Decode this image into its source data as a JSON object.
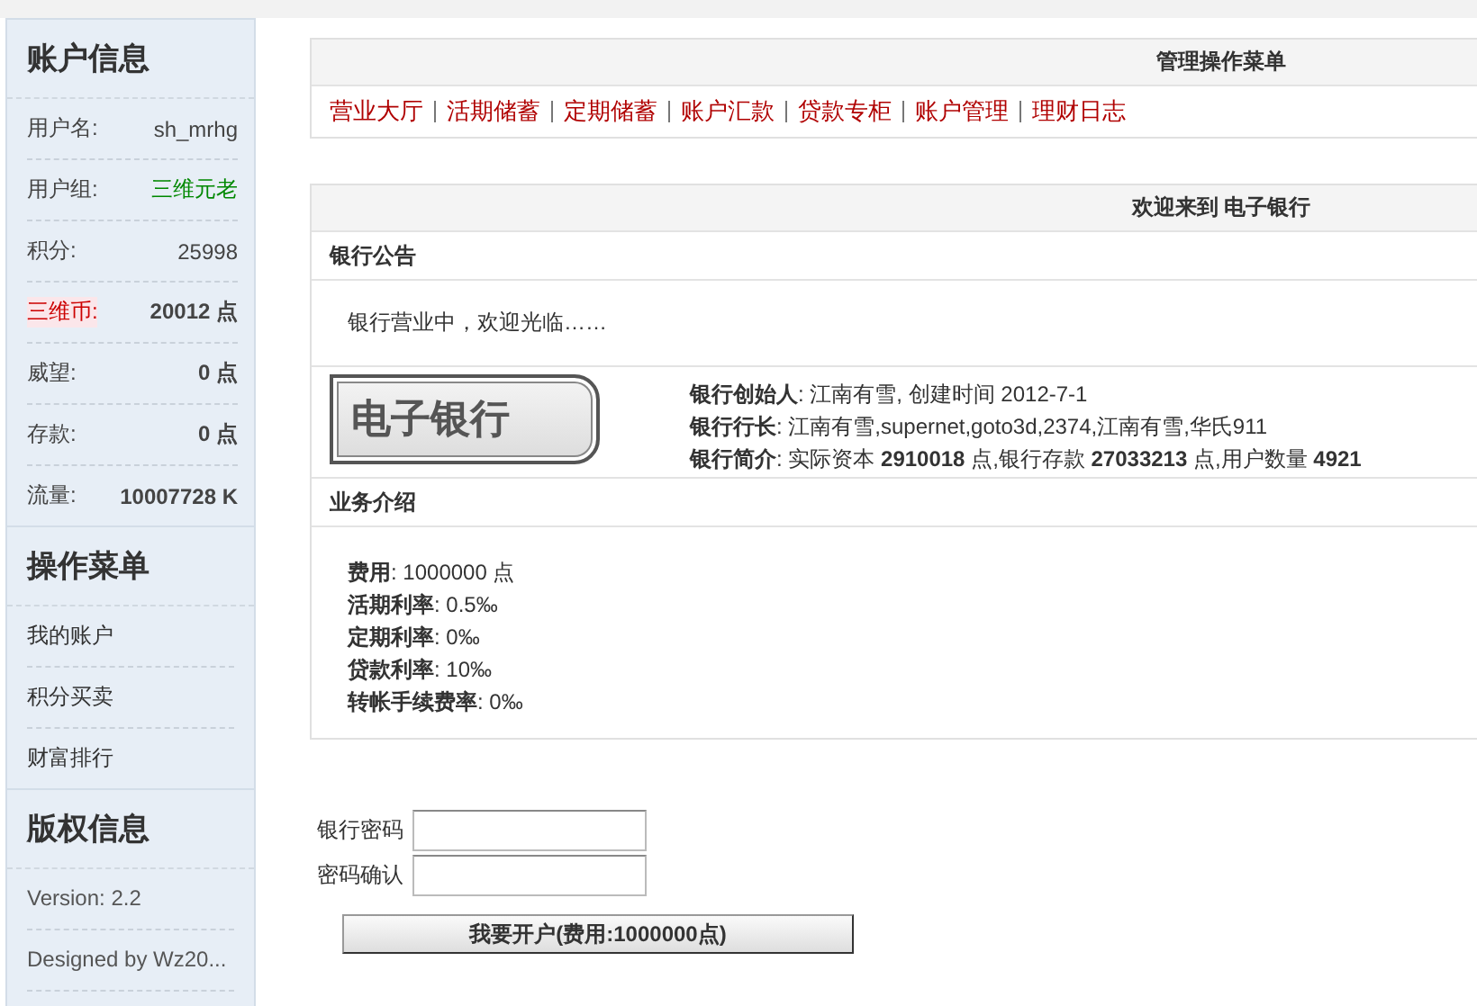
{
  "sidebar": {
    "account": {
      "title": "账户信息",
      "rows": [
        {
          "label": "用户名:",
          "value": "sh_mrhg",
          "kind": "normal"
        },
        {
          "label": "用户组:",
          "value": "三维元老",
          "kind": "group"
        },
        {
          "label": "积分:",
          "value": "25998",
          "kind": "normal"
        },
        {
          "label": "三维币:",
          "value": "20012 点",
          "kind": "currency"
        },
        {
          "label": "威望:",
          "value": "0 点",
          "kind": "strong"
        },
        {
          "label": "存款:",
          "value": "0 点",
          "kind": "strong"
        },
        {
          "label": "流量:",
          "value": "10007728 K",
          "kind": "strong"
        }
      ]
    },
    "menu": {
      "title": "操作菜单",
      "items": [
        "我的账户",
        "积分买卖",
        "财富排行"
      ]
    },
    "copyright": {
      "title": "版权信息",
      "lines": [
        "Version: 2.2",
        "Designed by Wz20..."
      ]
    }
  },
  "admin_menu": {
    "title": "管理操作菜单",
    "links": [
      "营业大厅",
      "活期储蓄",
      "定期储蓄",
      "账户汇款",
      "贷款专柜",
      "账户管理",
      "理财日志"
    ]
  },
  "bank": {
    "title": "欢迎来到 电子银行",
    "notice_heading": "银行公告",
    "notice": "银行营业中，欢迎光临……",
    "logo": "电子银行",
    "info": [
      "**银行创始人**: 江南有雪, 创建时间  2012-7-1",
      "**银行行长**: 江南有雪,supernet,goto3d,2374,江南有雪,华氏911",
      "**银行简介**: 实际资本  **2910018** 点,银行存款  **27033213** 点,用户数量  **4921**"
    ],
    "business_heading": "业务介绍",
    "business": [
      "**费用**: 1000000 点",
      "**活期利率**: 0.5‰",
      "**定期利率**: 0‰",
      "**贷款利率**: 10‰",
      "**转帐手续费率**: 0‰"
    ]
  },
  "form": {
    "fields": [
      {
        "label": "银行密码"
      },
      {
        "label": "密码确认"
      }
    ],
    "submit": "我要开户(费用:1000000点)"
  }
}
